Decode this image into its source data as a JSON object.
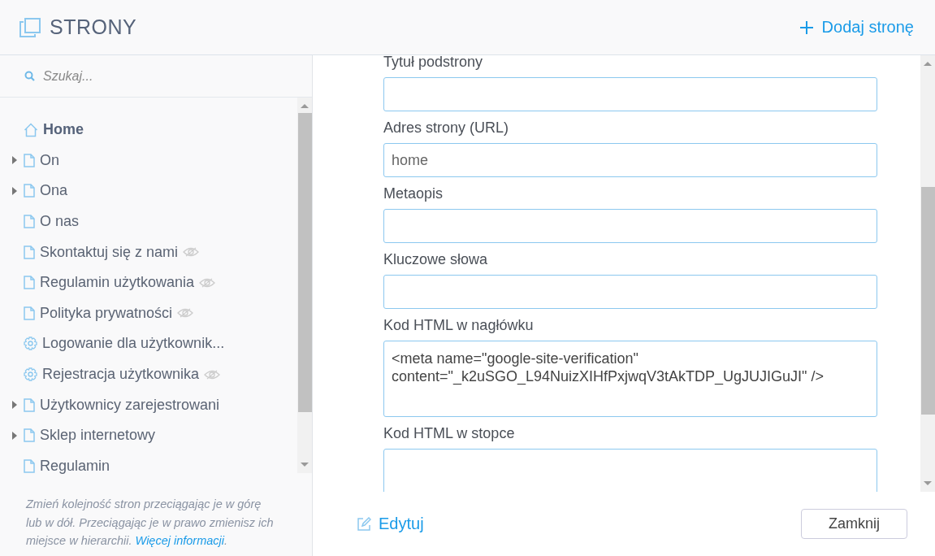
{
  "header": {
    "title": "STRONY",
    "add_button": "Dodaj stronę"
  },
  "search": {
    "placeholder": "Szukaj..."
  },
  "tree": [
    {
      "label": "Home",
      "kind": "home",
      "selected": true,
      "expandable": false,
      "hidden": false
    },
    {
      "label": "On",
      "kind": "page",
      "selected": false,
      "expandable": true,
      "hidden": false
    },
    {
      "label": "Ona",
      "kind": "page",
      "selected": false,
      "expandable": true,
      "hidden": false
    },
    {
      "label": "O nas",
      "kind": "page",
      "selected": false,
      "expandable": false,
      "hidden": false
    },
    {
      "label": "Skontaktuj się z nami",
      "kind": "page",
      "selected": false,
      "expandable": false,
      "hidden": true
    },
    {
      "label": "Regulamin użytkowania",
      "kind": "page",
      "selected": false,
      "expandable": false,
      "hidden": true
    },
    {
      "label": "Polityka prywatności",
      "kind": "page",
      "selected": false,
      "expandable": false,
      "hidden": true
    },
    {
      "label": "Logowanie dla użytkownik...",
      "kind": "settings",
      "selected": false,
      "expandable": false,
      "hidden": false
    },
    {
      "label": "Rejestracja użytkownika",
      "kind": "settings",
      "selected": false,
      "expandable": false,
      "hidden": true
    },
    {
      "label": "Użytkownicy zarejestrowani",
      "kind": "page",
      "selected": false,
      "expandable": true,
      "hidden": false
    },
    {
      "label": "Sklep internetowy",
      "kind": "page",
      "selected": false,
      "expandable": true,
      "hidden": false
    },
    {
      "label": "Regulamin",
      "kind": "page",
      "selected": false,
      "expandable": false,
      "hidden": false
    }
  ],
  "help": {
    "text": "Zmień kolejność stron przeciągając je w górę lub w dół. Przeciągając je w prawo zmienisz ich miejsce w hierarchii.",
    "link": "Więcej informacji",
    "after": "."
  },
  "form": [
    {
      "label": "Tytuł podstrony",
      "kind": "input"
    },
    {
      "label": "Adres strony (URL)",
      "kind": "input",
      "value": "home"
    },
    {
      "label": "Metaopis",
      "kind": "input"
    },
    {
      "label": "Kluczowe słowa",
      "kind": "input"
    },
    {
      "label": "Kod HTML w nagłówku",
      "kind": "textarea",
      "value": "<meta name=\"google-site-verification\" content=\"_k2uSGO_L94NuizXIHfPxjwqV3tAkTDP_UgJUJIGuJI\" />"
    },
    {
      "label": "Kod HTML w stopce",
      "kind": "textarea"
    }
  ],
  "footer": {
    "edit": "Edytuj",
    "close": "Zamknij"
  }
}
